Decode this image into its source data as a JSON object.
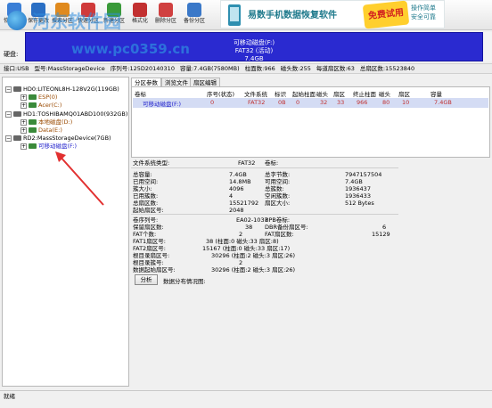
{
  "toolbar": {
    "buttons": [
      {
        "label": "恢复文件",
        "color": "#3b7fd6"
      },
      {
        "label": "保存更改",
        "color": "#2a6fc4"
      },
      {
        "label": "搜索分区",
        "color": "#e08a1e"
      },
      {
        "label": "快速分区",
        "color": "#d03a3a"
      },
      {
        "label": "新建分区",
        "color": "#3a9a3a"
      },
      {
        "label": "格式化",
        "color": "#c23030"
      },
      {
        "label": "删除分区",
        "color": "#d04040"
      },
      {
        "label": "备份分区",
        "color": "#3a78c8"
      }
    ]
  },
  "watermark": {
    "title": "河东软件园",
    "url": "www.pc0359.cn"
  },
  "banner": {
    "text": "易数手机数据恢复软件",
    "badge": "免费试用",
    "right1": "操作简单",
    "right2": "安全可靠"
  },
  "disk_strip": {
    "label": "硬盘:",
    "line1": "可移动磁盘(F:)",
    "line2": "FAT32 (活动)",
    "line3": "7.4GB"
  },
  "infoline": [
    "接口:USB",
    "型号:MassStorageDevice",
    "序列号:125D20140310",
    "容量:7.4GB(7580MB)",
    "柱面数:966",
    "磁头数:255",
    "每道扇区数:63",
    "总扇区数:15523840"
  ],
  "tree": [
    {
      "label": "HD0:LITEONL8H-128V2G(119GB)",
      "kind": "disk"
    },
    {
      "label": "ESP(0)",
      "kind": "part"
    },
    {
      "label": "Acer(C:)",
      "kind": "part"
    },
    {
      "label": "HD1:TOSHIBAMQ01ABD100(932GB)",
      "kind": "disk"
    },
    {
      "label": "本地磁盘(D:)",
      "kind": "part"
    },
    {
      "label": "Data(E:)",
      "kind": "part"
    },
    {
      "label": "RD2:MassStorageDevice(7GB)",
      "kind": "disk"
    },
    {
      "label": "可移动磁盘(F:)",
      "kind": "sel"
    }
  ],
  "tabs": [
    "分区参数",
    "浏览文件",
    "扇区编辑"
  ],
  "table": {
    "headers": [
      "卷标",
      "序号(状态)",
      "文件系统",
      "标识",
      "起始柱面",
      "磁头",
      "扇区",
      "终止柱面",
      "磁头",
      "扇区",
      "容量"
    ],
    "row": [
      "可移动磁盘(F:)",
      "0",
      "FAT32",
      "0B",
      "0",
      "32",
      "33",
      "966",
      "80",
      "10",
      "7.4GB"
    ]
  },
  "fs": {
    "type_label": "文件系统类型:",
    "type_value": "FAT32",
    "vol_label": "卷标:",
    "left": [
      [
        "总容量:",
        "7.4GB"
      ],
      [
        "已用空间:",
        "14.8MB"
      ],
      [
        "簇大小:",
        "4096"
      ],
      [
        "已用簇数:",
        "4"
      ],
      [
        "总扇区数:",
        "15521792"
      ],
      [
        "起始扇区号:",
        "2048"
      ]
    ],
    "right": [
      [
        "总字节数:",
        "7947157504"
      ],
      [
        "可用空间:",
        "7.4GB"
      ],
      [
        "总簇数:",
        "1936437"
      ],
      [
        "空闲簇数:",
        "1936433"
      ],
      [
        "扇区大小:",
        "512 Bytes"
      ],
      [
        "",
        ""
      ]
    ],
    "left2": [
      [
        "卷序列号:",
        "EA02-1037"
      ],
      [
        "保留扇区数:",
        "38"
      ],
      [
        "FAT个数:",
        "2"
      ],
      [
        "FAT1扇区号:",
        "38 (柱面:0 磁头:33 扇区:8)"
      ],
      [
        "FAT2扇区号:",
        "15167 (柱面:0 磁头:33 扇区:17)"
      ],
      [
        "根目录扇区号:",
        "30296 (柱面:2 磁头:3 扇区:26)"
      ],
      [
        "根目录簇号:",
        "2"
      ],
      [
        "数据起始扇区号:",
        "30296 (柱面:2 磁头:3 扇区:26)"
      ]
    ],
    "right2": [
      [
        "BPB卷标:",
        ""
      ],
      [
        "DBR备份扇区号:",
        "6"
      ],
      [
        "FAT扇区数:",
        "15129"
      ]
    ]
  },
  "analyze": {
    "button": "分析",
    "label": "数据分布情况图:"
  },
  "status": "就绪"
}
